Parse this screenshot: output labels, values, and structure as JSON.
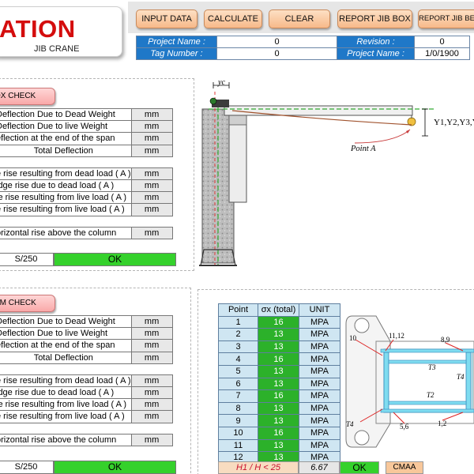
{
  "header": {
    "title": "ATION",
    "subtitle": "JIB CRANE"
  },
  "toolbar": {
    "input_data": "INPUT DATA",
    "calculate": "CALCULATE",
    "clear": "CLEAR",
    "report_jib_box": "REPORT JIB BOX",
    "report_jib_beam": "REPORT JIB BEA"
  },
  "project": {
    "project_name_label": "Project Name :",
    "project_name_value": "0",
    "tag_number_label": "Tag Number :",
    "tag_number_value": "0",
    "revision_label": "Revision :",
    "revision_value": "0",
    "project_name2_label": "Project Name :",
    "project_name2_value": "1/0/1900"
  },
  "box_check": {
    "button_label": "OX CHECK",
    "rows": [
      {
        "label": "Deflection Due to Dead Weight",
        "unit": "mm"
      },
      {
        "label": " Deflection Due to live Weight",
        "unit": "mm"
      },
      {
        "label": "eflection at the end of the span",
        "unit": "mm"
      },
      {
        "label": "Total Deflection",
        "unit": "mm"
      }
    ],
    "rise_rows": [
      {
        "label": "e rise resulting from dead load ( A )",
        "unit": "mm"
      },
      {
        "label": "idge rise due to dead load ( A )",
        "unit": "mm"
      },
      {
        "label": "le rise resulting from live load ( A )",
        "unit": "mm"
      },
      {
        "label": "e rise resulting from live load  ( A )",
        "unit": "mm"
      }
    ],
    "horizontal_row": {
      "label": "orizontal rise above the column",
      "unit": "mm"
    },
    "status_label": "S/250",
    "status_value": "OK"
  },
  "beam_check": {
    "button_label": "AM CHECK",
    "rows": [
      {
        "label": "Deflection Due to Dead Weight",
        "unit": "mm"
      },
      {
        "label": " Deflection Due to live Weight",
        "unit": "mm"
      },
      {
        "label": "eflection at the end of the span",
        "unit": "mm"
      },
      {
        "label": "Total Deflection",
        "unit": "mm"
      }
    ],
    "rise_rows": [
      {
        "label": "e rise resulting from dead load ( A )",
        "unit": "mm"
      },
      {
        "label": "idge rise due to dead load ( A )",
        "unit": "mm"
      },
      {
        "label": "le rise resulting from live load ( A )",
        "unit": "mm"
      },
      {
        "label": "e rise resulting from live load  ( A )",
        "unit": "mm"
      }
    ],
    "horizontal_row": {
      "label": "orizontal rise above the column",
      "unit": "mm"
    },
    "status_label": "S/250",
    "status_value": "OK"
  },
  "crane_diagram": {
    "yc_label": "yc",
    "y_label": "Y1,Y2,Y3,Y",
    "point_label": "Point A"
  },
  "stress_table": {
    "headers": [
      "Point",
      "σx (total)",
      "UNIT"
    ],
    "rows": [
      {
        "point": "1",
        "sigma": "16",
        "unit": "MPA"
      },
      {
        "point": "2",
        "sigma": "13",
        "unit": "MPA"
      },
      {
        "point": "3",
        "sigma": "13",
        "unit": "MPA"
      },
      {
        "point": "4",
        "sigma": "16",
        "unit": "MPA"
      },
      {
        "point": "5",
        "sigma": "13",
        "unit": "MPA"
      },
      {
        "point": "6",
        "sigma": "13",
        "unit": "MPA"
      },
      {
        "point": "7",
        "sigma": "16",
        "unit": "MPA"
      },
      {
        "point": "8",
        "sigma": "13",
        "unit": "MPA"
      },
      {
        "point": "9",
        "sigma": "13",
        "unit": "MPA"
      },
      {
        "point": "10",
        "sigma": "16",
        "unit": "MPA"
      },
      {
        "point": "11",
        "sigma": "13",
        "unit": "MPA"
      },
      {
        "point": "12",
        "sigma": "13",
        "unit": "MPA"
      }
    ],
    "ratio_label": "H1 / H  < 25",
    "ratio_value": "6.67",
    "ratio_status": "OK",
    "standard": "CMAA"
  },
  "section_diagram": {
    "labels": {
      "p10": "10",
      "p1112": "11,12",
      "p89": "8,9",
      "t3": "T3",
      "t4a": "T4",
      "t2": "T2",
      "t4b": "T4",
      "p56": "5,6",
      "p12": "1,2"
    }
  },
  "colors": {
    "accent_red": "#d40d0d",
    "meta_blue": "#1f78c8",
    "ok_green": "#35d12c",
    "stress_green": "#2cb12a",
    "button_orange": "#f7b98a",
    "button_pink": "#f9a9a9"
  }
}
